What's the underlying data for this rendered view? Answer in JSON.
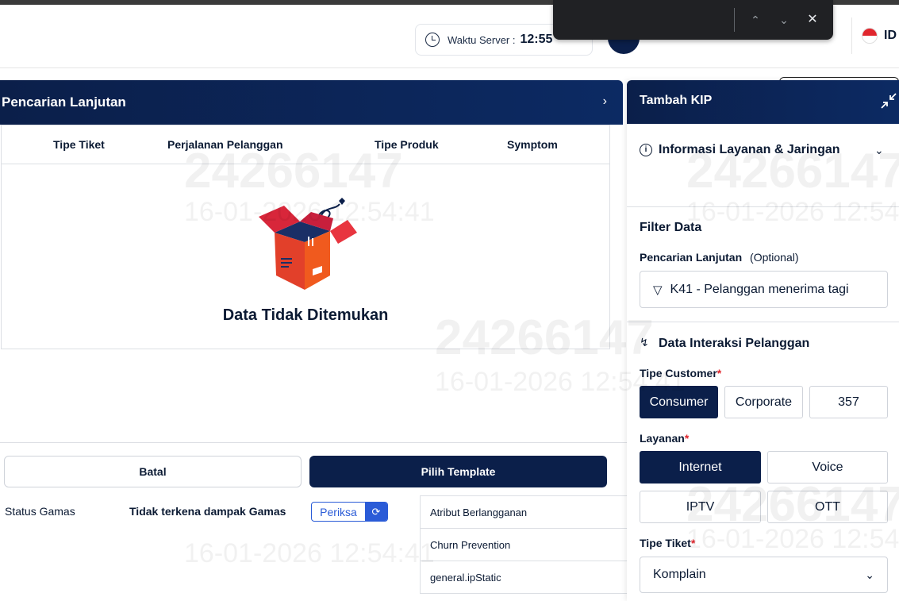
{
  "header": {
    "server_time_label": "Waktu Server :",
    "server_time_value": "12:55",
    "language": "ID"
  },
  "left_panel": {
    "title": "Pencarian Lanjutan",
    "columns": [
      "Tipe Tiket",
      "Perjalanan Pelanggan",
      "Tipe Produk",
      "Symptom"
    ],
    "empty_message": "Data Tidak Ditemukan"
  },
  "actions": {
    "cancel": "Batal",
    "choose_template": "Pilih Template"
  },
  "gamas": {
    "label": "Status Gamas",
    "value": "Tidak terkena dampak Gamas",
    "check_label": "Periksa"
  },
  "attributes": [
    "Atribut Berlangganan",
    "Churn Prevention",
    "general.ipStatic"
  ],
  "right_panel": {
    "title": "Tambah KIP",
    "section_info": "Informasi Layanan & Jaringan",
    "filter_title": "Filter Data",
    "advanced_search_label": "Pencarian Lanjutan",
    "advanced_search_optional": "(Optional)",
    "advanced_search_value": "K41 - Pelanggan menerima tagi",
    "interaction_title": "Data Interaksi Pelanggan",
    "customer_type_label": "Tipe Customer",
    "customer_types": [
      "Consumer",
      "Corporate",
      "357"
    ],
    "service_label": "Layanan",
    "services": [
      "Internet",
      "Voice",
      "IPTV",
      "OTT"
    ],
    "ticket_type_label": "Tipe Tiket",
    "ticket_type_value": "Komplain",
    "required_mark": "*"
  },
  "watermark": {
    "id": "24266147",
    "timestamp": "16-01-2026 12:54:41"
  },
  "colors": {
    "navy": "#0b1f4a",
    "accent_blue": "#2a5bd7",
    "required_red": "#e0262d"
  }
}
